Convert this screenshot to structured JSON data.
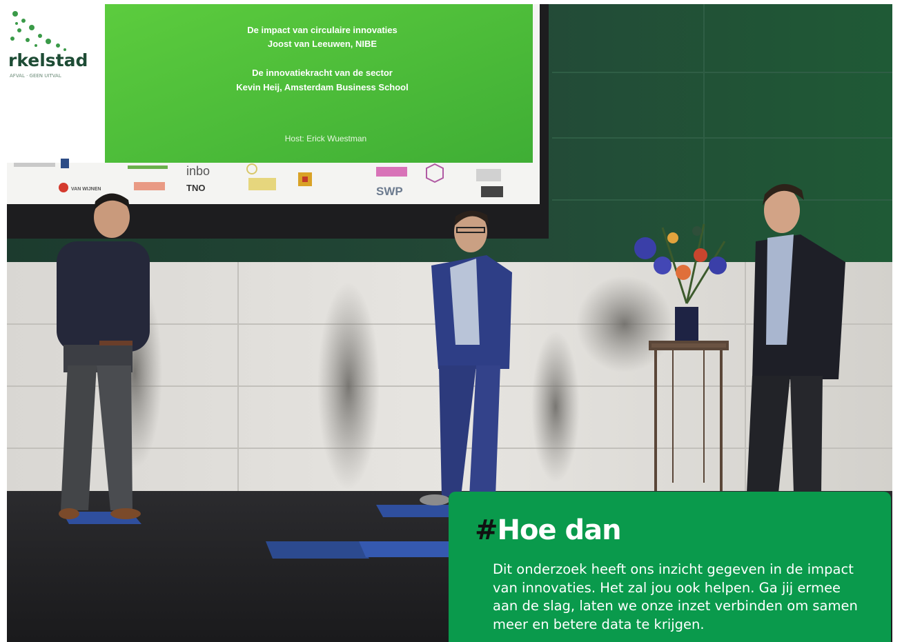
{
  "slide": {
    "logo_text": "rkelstad",
    "logo_tagline": "AFVAL · GEEN UITVAL",
    "talk1_title": "De impact van circulaire innovaties",
    "talk1_speaker": "Joost van Leeuwen, NIBE",
    "talk2_title": "De innovatiekracht van de sector",
    "talk2_speaker": "Kevin Heij, Amsterdam Business School",
    "host": "Host: Erick Wuestman",
    "sponsors": [
      "inbo",
      "TNO",
      "SWP",
      "VAN WIJNEN"
    ],
    "green": "#4fbf3a"
  },
  "card": {
    "hash": "#",
    "heading": "Hoe dan",
    "body_lines": [
      "Dit onderzoek heeft ons inzicht gegeven in de impact",
      "van innovaties. Het zal jou ook helpen. Ga jij ermee",
      "aan de slag, laten we onze inzet verbinden om samen",
      "meer en betere data te krijgen."
    ],
    "background": "#0a9a4c"
  }
}
